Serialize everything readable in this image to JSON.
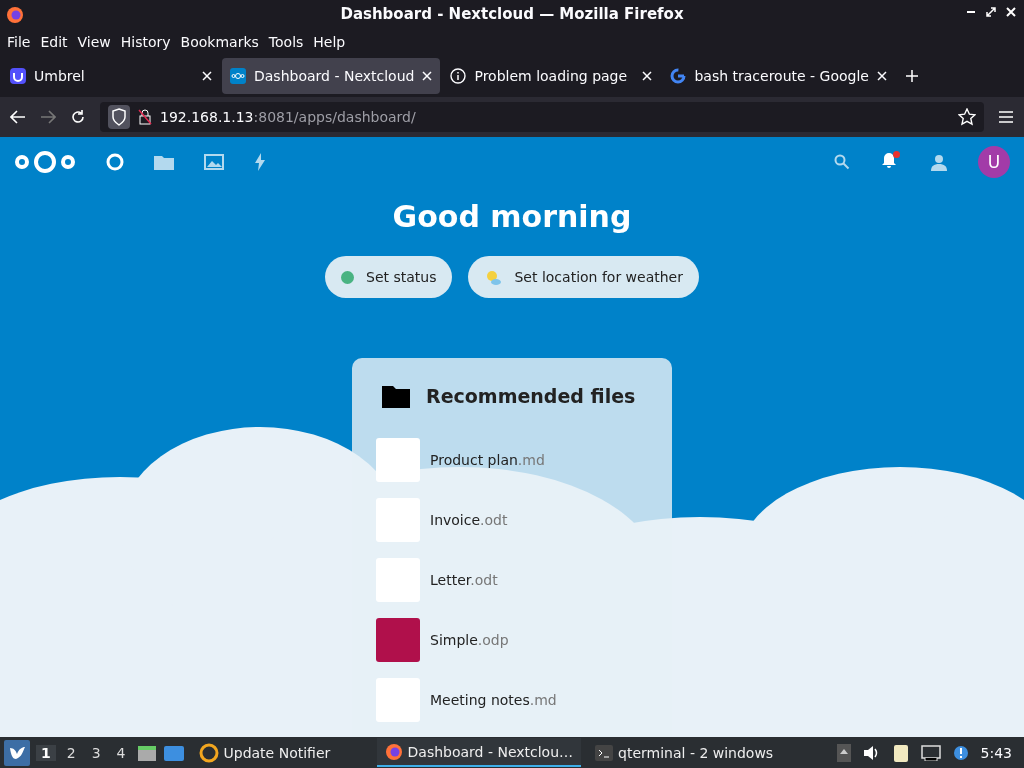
{
  "window": {
    "title": "Dashboard - Nextcloud — Mozilla Firefox"
  },
  "menu": [
    "File",
    "Edit",
    "View",
    "History",
    "Bookmarks",
    "Tools",
    "Help"
  ],
  "tabs": [
    {
      "label": "Umbrel",
      "kind": "umbrel",
      "selected": false
    },
    {
      "label": "Dashboard - Nextcloud",
      "kind": "nextcloud",
      "selected": true
    },
    {
      "label": "Problem loading page",
      "kind": "info",
      "selected": false
    },
    {
      "label": "bash traceroute - Google",
      "kind": "google",
      "selected": false
    }
  ],
  "address": {
    "host": "192.168.1.13",
    "rest": ":8081/apps/dashboard/"
  },
  "header": {
    "avatar": "U",
    "notification_badge": true
  },
  "greeting": "Good morning",
  "actions": [
    {
      "label": "Set status",
      "kind": "status"
    },
    {
      "label": "Set location for weather",
      "kind": "weather"
    }
  ],
  "panel": {
    "title": "Recommended files",
    "files": [
      {
        "name": "Product plan",
        "ext": ".md",
        "kind": "doc"
      },
      {
        "name": "Invoice",
        "ext": ".odt",
        "kind": "doc"
      },
      {
        "name": "Letter",
        "ext": ".odt",
        "kind": "doc"
      },
      {
        "name": "Simple",
        "ext": ".odp",
        "kind": "slide"
      },
      {
        "name": "Meeting notes",
        "ext": ".md",
        "kind": "doc"
      }
    ]
  },
  "taskbar": {
    "desktops": [
      {
        "label": "1",
        "selected": true
      },
      {
        "label": "2",
        "selected": false
      },
      {
        "label": "3",
        "selected": false
      },
      {
        "label": "4",
        "selected": false
      }
    ],
    "tasks": [
      {
        "label": "Update Notifier",
        "kind": "update",
        "selected": false
      },
      {
        "label": "Dashboard - Nextclou…",
        "kind": "firefox",
        "selected": true
      },
      {
        "label": "qterminal - 2 windows",
        "kind": "terminal",
        "selected": false
      }
    ],
    "clock": "5:43"
  }
}
